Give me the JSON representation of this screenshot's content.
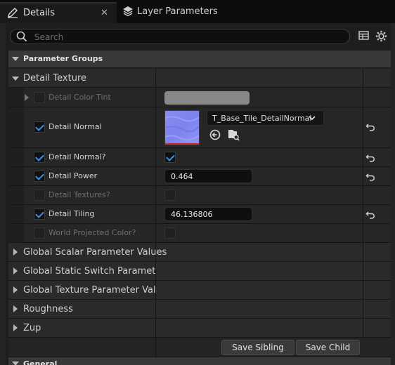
{
  "tabs": [
    {
      "label": "Details",
      "icon": "pencil-icon",
      "active": true,
      "close_glyph": "✕"
    },
    {
      "label": "Layer Parameters",
      "icon": "layers-icon",
      "active": false
    }
  ],
  "search": {
    "placeholder": "Search",
    "value": ""
  },
  "toolbar": {
    "table_view_icon": "table-icon",
    "settings_icon": "gear-icon"
  },
  "parameter_groups": {
    "header": "Parameter Groups",
    "expanded": true
  },
  "detail_texture": {
    "label": "Detail Texture",
    "expanded": true,
    "params": [
      {
        "label": "Detail Color Tint",
        "enabled": false,
        "type": "color",
        "value_color": "#9a9a9a"
      },
      {
        "label": "Detail Normal",
        "enabled": true,
        "type": "texture",
        "asset": "T_Base_Tile_DetailNormal"
      },
      {
        "label": "Detail Normal?",
        "enabled": true,
        "type": "bool",
        "value": true
      },
      {
        "label": "Detail Power",
        "enabled": true,
        "type": "scalar",
        "value": "0.464"
      },
      {
        "label": "Detail Textures?",
        "enabled": false,
        "type": "bool",
        "value": false
      },
      {
        "label": "Detail Tiling",
        "enabled": true,
        "type": "scalar",
        "value": "46.136806"
      },
      {
        "label": "World Projected Color?",
        "enabled": false,
        "type": "bool",
        "value": false
      }
    ]
  },
  "groups": [
    "Global Scalar Parameter Values",
    "Global Static Switch Parameter V",
    "Global Texture Parameter Values",
    "Roughness",
    "Zup"
  ],
  "buttons": {
    "save_sibling": "Save Sibling",
    "save_child": "Save Child"
  },
  "next_section": {
    "label": "General"
  },
  "colors": {
    "accent": "#3a8df0",
    "background": "#151515",
    "panel": "#242424"
  }
}
